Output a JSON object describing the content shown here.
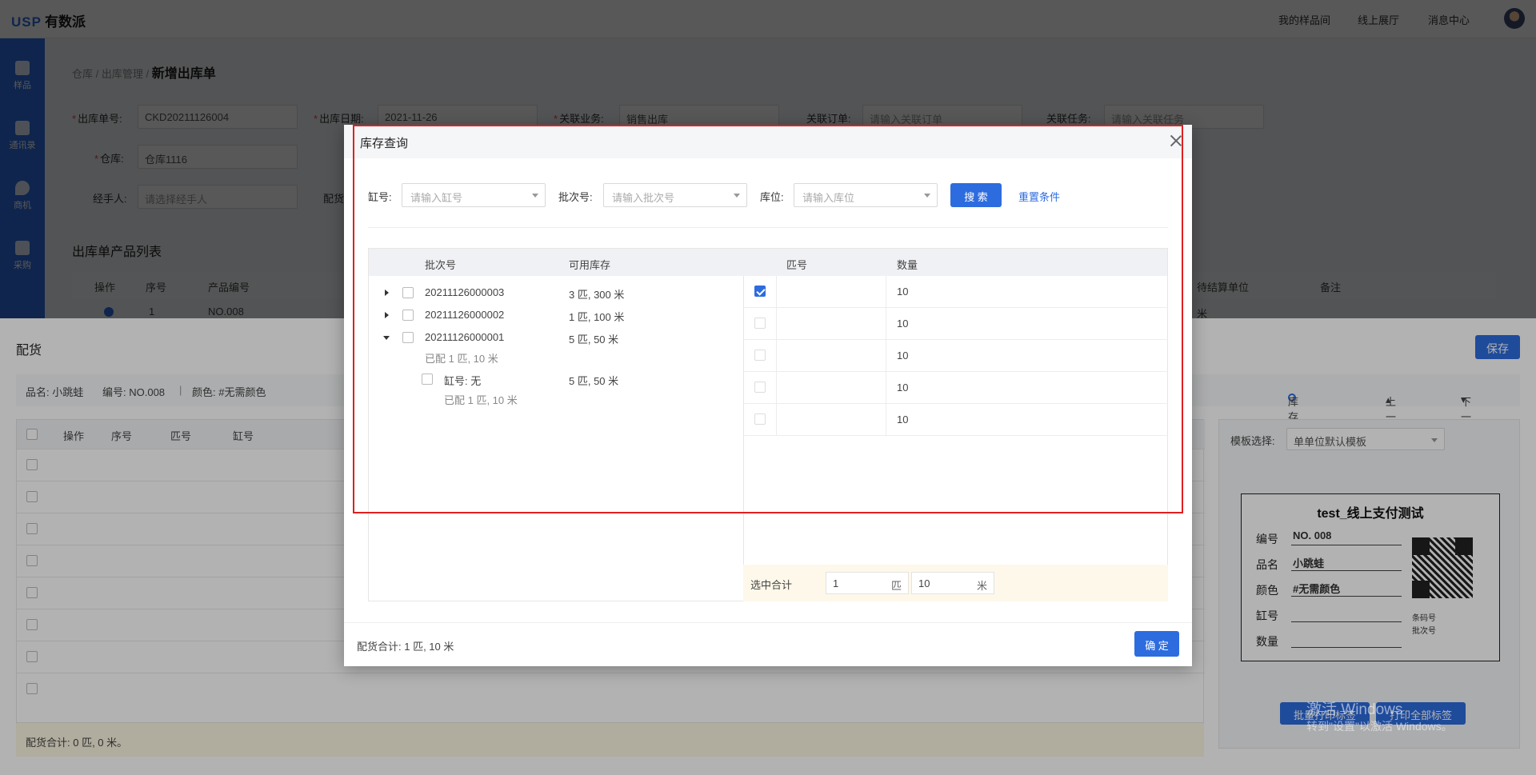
{
  "topbar": {
    "logo_usp": "USP",
    "logo_text": "有数派",
    "nav": [
      "我的样品间",
      "线上展厅",
      "消息中心"
    ]
  },
  "sidebar": {
    "items": [
      {
        "label": "样品",
        "icon": "sample-icon"
      },
      {
        "label": "通讯录",
        "icon": "contacts-icon"
      },
      {
        "label": "商机",
        "icon": "location-icon"
      },
      {
        "label": "采购",
        "icon": "purchase-icon"
      }
    ]
  },
  "page": {
    "breadcrumb": [
      "仓库",
      "出库管理"
    ],
    "title": "新增出库单",
    "form": {
      "order_no_label": "出库单号:",
      "order_no_value": "CKD20211126004",
      "date_label": "出库日期:",
      "date_value": "2021-11-26",
      "biz_label": "关联业务:",
      "biz_value": "销售出库",
      "related_order_label": "关联订单:",
      "related_order_placeholder": "请输入关联订单",
      "related_task_label": "关联任务:",
      "related_task_placeholder": "请输入关联任务",
      "warehouse_label": "仓库:",
      "warehouse_value": "仓库1116",
      "handler_label": "经手人:",
      "handler_placeholder": "请选择经手人",
      "partial_label": "配货"
    },
    "list_title": "出库单产品列表",
    "list_headers": [
      "操作",
      "序号",
      "产品编号",
      "待结算单位",
      "备注"
    ],
    "list_row": {
      "seq": "1",
      "code": "NO.008",
      "unit": "米"
    }
  },
  "drawer": {
    "title": "配货",
    "save_label": "保存",
    "info": {
      "name": "品名: 小跳蛙",
      "code": "编号: NO.008",
      "sep": "|",
      "color": "颜色: #无需颜色",
      "stock_query": "库存查询",
      "prev": "上一个",
      "next": "下一个"
    },
    "table_headers": [
      "操作",
      "序号",
      "匹号",
      "缸号"
    ],
    "footer": "配货合计: 0 匹, 0 米。",
    "template_label": "模板选择:",
    "template_value": "单单位默认模板",
    "label_card": {
      "title": "test_线上支付测试",
      "rows": [
        {
          "k": "编号",
          "v": "NO. 008"
        },
        {
          "k": "品名",
          "v": "小跳蛙"
        },
        {
          "k": "颜色",
          "v": "#无需颜色"
        },
        {
          "k": "缸号",
          "v": ""
        },
        {
          "k": "数量",
          "v": ""
        }
      ],
      "barcode_label": "条码号",
      "batch_label": "批次号"
    },
    "bottom_btn1": "批量打印标签",
    "bottom_btn2": "打印全部标签"
  },
  "modal": {
    "title": "库存查询",
    "filters": {
      "vat_label": "缸号:",
      "vat_placeholder": "请输入缸号",
      "batch_label": "批次号:",
      "batch_placeholder": "请输入批次号",
      "loc_label": "库位:",
      "loc_placeholder": "请输入库位",
      "search_label": "搜 索",
      "reset_label": "重置条件"
    },
    "left_headers": [
      "批次号",
      "可用库存"
    ],
    "batches": [
      {
        "no": "20211126000003",
        "stock": "3 匹, 300 米",
        "expanded": false
      },
      {
        "no": "20211126000002",
        "stock": "1 匹, 100 米",
        "expanded": false
      },
      {
        "no": "20211126000001",
        "stock": "5 匹, 50 米",
        "expanded": true,
        "allocated": "已配 1 匹, 10 米",
        "children": [
          {
            "vat": "缸号: 无",
            "stock": "5 匹, 50 米",
            "allocated": "已配 1 匹, 10 米"
          }
        ]
      }
    ],
    "right_headers": [
      "匹号",
      "数量"
    ],
    "rows": [
      {
        "piece": "",
        "qty": "10",
        "checked": true
      },
      {
        "piece": "",
        "qty": "10",
        "checked": false
      },
      {
        "piece": "",
        "qty": "10",
        "checked": false
      },
      {
        "piece": "",
        "qty": "10",
        "checked": false
      },
      {
        "piece": "",
        "qty": "10",
        "checked": false
      }
    ],
    "summary": {
      "label": "选中合计",
      "pieces": "1",
      "pieces_unit": "匹",
      "meters": "10",
      "meters_unit": "米"
    },
    "footer_total": "配货合计: 1 匹, 10 米",
    "confirm_label": "确 定"
  },
  "watermark": {
    "line1": "激活 Windows",
    "line2": "转到\"设置\"以激活 Windows。"
  },
  "colors": {
    "primary": "#2d6cdf",
    "highlight_box": "#e02020",
    "required": "#e34d4d"
  }
}
